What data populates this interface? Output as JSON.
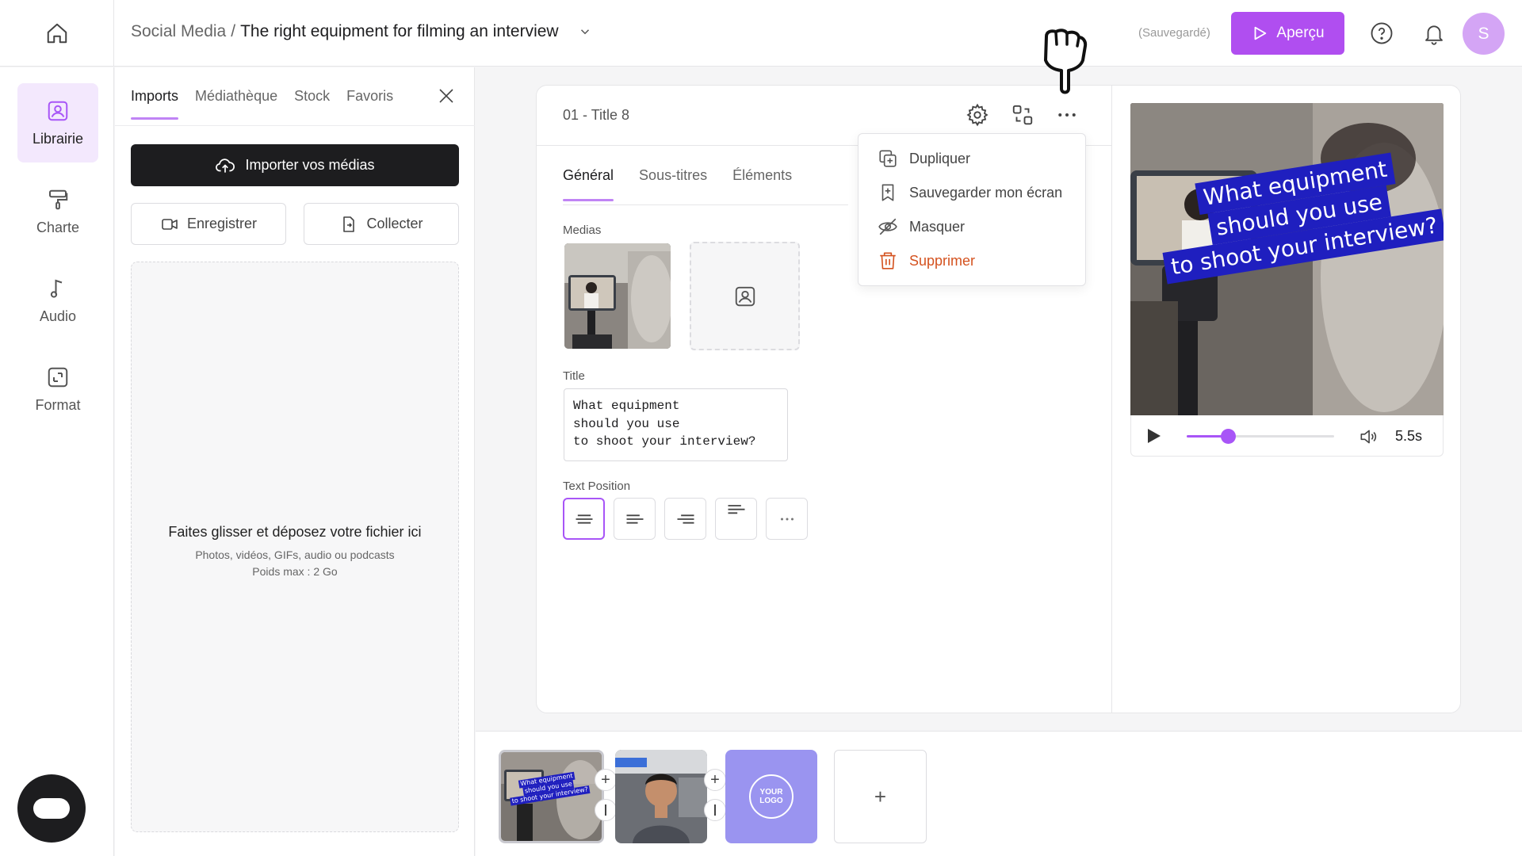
{
  "header": {
    "breadcrumb_parent": "Social Media",
    "breadcrumb_separator": "/",
    "project_title": "The right equipment for filming an interview",
    "saved_status": "(Sauvegardé)",
    "preview_label": "Aperçu",
    "avatar_initial": "S",
    "accent_color": "#b04ef0"
  },
  "nav": {
    "items": [
      {
        "label": "Librairie",
        "icon": "library-icon",
        "active": true
      },
      {
        "label": "Charte",
        "icon": "paint-roller-icon"
      },
      {
        "label": "Audio",
        "icon": "music-note-icon"
      },
      {
        "label": "Format",
        "icon": "format-resize-icon"
      }
    ]
  },
  "library": {
    "tabs": [
      "Imports",
      "Médiathèque",
      "Stock",
      "Favoris"
    ],
    "active_tab": "Imports",
    "import_label": "Importer vos médias",
    "record_label": "Enregistrer",
    "collect_label": "Collecter",
    "drop_title": "Faites glisser et déposez votre fichier ici",
    "drop_subtitle": "Photos, vidéos, GIFs, audio ou podcasts",
    "drop_max": "Poids max : 2 Go"
  },
  "editor": {
    "scene_title": "01 - Title 8",
    "tabs": [
      "Général",
      "Sous-titres",
      "Éléments"
    ],
    "active_tab": "Général",
    "medias_label": "Medias",
    "title_label": "Title",
    "title_lines": [
      "What equipment",
      "should you use",
      "to shoot your interview?"
    ],
    "text_position_label": "Text Position",
    "text_position_options": [
      "center",
      "left",
      "right",
      "top-left",
      "more"
    ],
    "selected_text_position": "center"
  },
  "context_menu": {
    "items": [
      {
        "label": "Dupliquer",
        "icon": "duplicate-icon"
      },
      {
        "label": "Sauvegarder mon écran",
        "icon": "bookmark-plus-icon"
      },
      {
        "label": "Masquer",
        "icon": "eye-off-icon"
      },
      {
        "label": "Supprimer",
        "icon": "trash-icon",
        "danger": true
      }
    ],
    "danger_color": "#d4521f"
  },
  "preview": {
    "caption_lines": [
      "What equipment",
      "should you use",
      "to shoot your interview?"
    ],
    "caption_bg": "#1f1fbf",
    "duration": "5.5s",
    "progress": 0.28
  },
  "timeline": {
    "scenes": [
      {
        "type": "video",
        "caption": [
          "What equipment",
          "should you use",
          "to shoot your interview?"
        ],
        "selected": true
      },
      {
        "type": "video"
      },
      {
        "type": "logo",
        "logo_text": "YOUR LOGO"
      }
    ],
    "add_label": "+"
  }
}
